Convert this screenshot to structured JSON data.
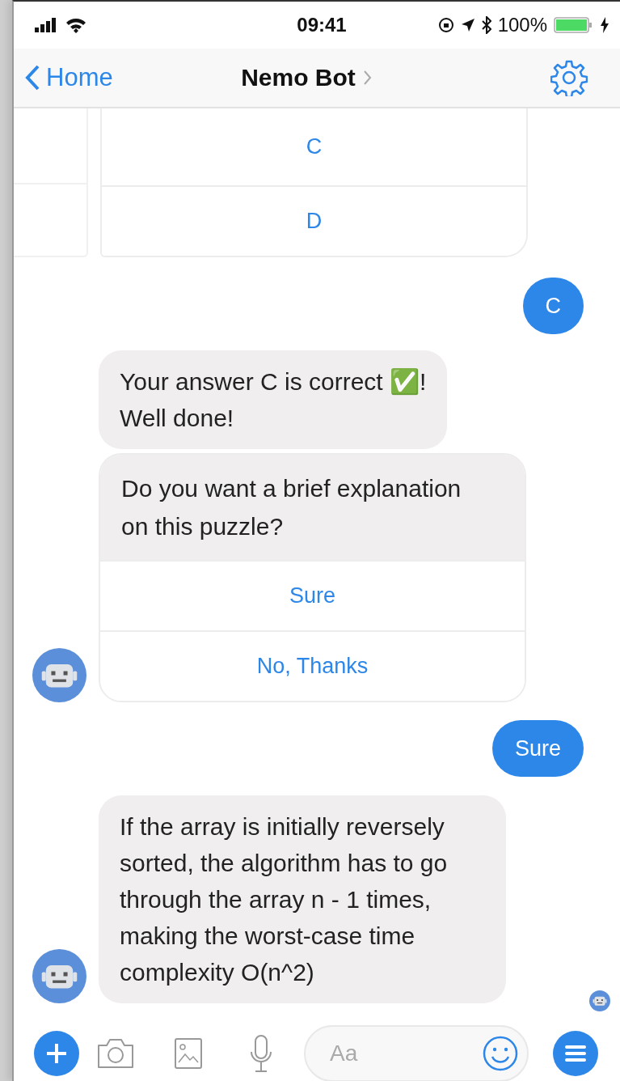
{
  "status_bar": {
    "time": "09:41",
    "battery": "100%"
  },
  "nav": {
    "back": "Home",
    "title": "Nemo Bot"
  },
  "messages": [
    {
      "kind": "carousel",
      "options": [
        "C",
        "D"
      ]
    },
    {
      "kind": "outgoing",
      "text": "C"
    },
    {
      "kind": "incoming",
      "text": "Your answer C is correct ✅!\nWell done!",
      "avatar": false
    },
    {
      "kind": "quick_reply",
      "text": "Do you want a brief explanation on this puzzle?",
      "buttons": [
        "Sure",
        "No, Thanks"
      ],
      "avatar": true
    },
    {
      "kind": "outgoing",
      "text": "Sure"
    },
    {
      "kind": "incoming",
      "text": "If the array is initially reversely sorted, the algorithm has to go through the array n - 1 times, making the worst-case time complexity O(n^2)",
      "avatar": true
    }
  ],
  "composer": {
    "placeholder": "Aa"
  }
}
